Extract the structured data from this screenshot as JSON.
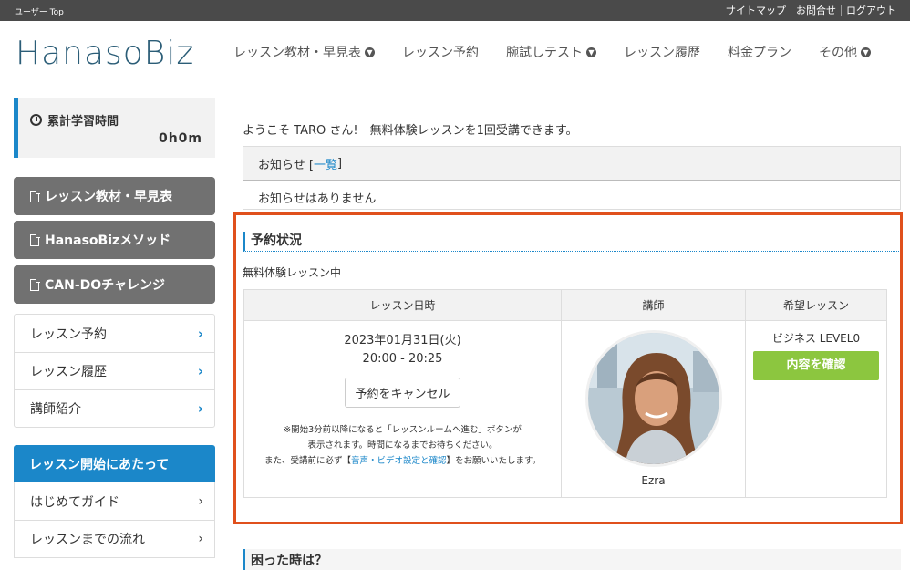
{
  "topbar": {
    "crumb": "ユーザー Top",
    "links": [
      "サイトマップ",
      "お問合せ",
      "ログアウト"
    ]
  },
  "logo": "HanasoBiz",
  "nav": [
    {
      "label": "レッスン教材・早見表",
      "dropdown": true
    },
    {
      "label": "レッスン予約",
      "dropdown": false
    },
    {
      "label": "腕試しテスト",
      "dropdown": true
    },
    {
      "label": "レッスン履歴",
      "dropdown": false
    },
    {
      "label": "料金プラン",
      "dropdown": false
    },
    {
      "label": "その他",
      "dropdown": true
    }
  ],
  "sidebar": {
    "study_label": "累計学習時間",
    "study_value": "0h0m",
    "gray_buttons": [
      "レッスン教材・早見表",
      "HanasoBizメソッド",
      "CAN-DOチャレンジ"
    ],
    "menu": [
      "レッスン予約",
      "レッスン履歴",
      "講師紹介"
    ],
    "section_head": "レッスン開始にあたって",
    "menu2": [
      "はじめてガイド",
      "レッスンまでの流れ"
    ]
  },
  "main": {
    "welcome": "ようこそ TARO さん!　無料体験レッスンを1回受講できます。",
    "notice_head": "お知らせ [",
    "notice_link": "一覧",
    "notice_close": "]",
    "notice_body": "お知らせはありません",
    "reservation_title": "予約状況",
    "trial_label": "無料体験レッスン中",
    "table": {
      "headers": [
        "レッスン日時",
        "講師",
        "希望レッスン"
      ],
      "date": "2023年01月31日(火)",
      "time": "20:00 - 20:25",
      "cancel_label": "予約をキャンセル",
      "note1": "※開始3分前以降になると「レッスンルームへ進む」ボタンが",
      "note2": "表示されます。時間になるまでお待ちください。",
      "note3a": "また、受講前に必ず【",
      "note3link": "音声・ビデオ設定と確認",
      "note3b": "】をお願いいたします。",
      "teacher_name": "Ezra",
      "lesson_name": "ビジネス LEVEL0",
      "confirm_label": "内容を確認"
    },
    "help_title": "困った時は？"
  },
  "colors": {
    "accent": "#1b87c9",
    "highlight_border": "#e0501c",
    "confirm_green": "#8cc63f",
    "topbar": "#4a4a4a"
  }
}
